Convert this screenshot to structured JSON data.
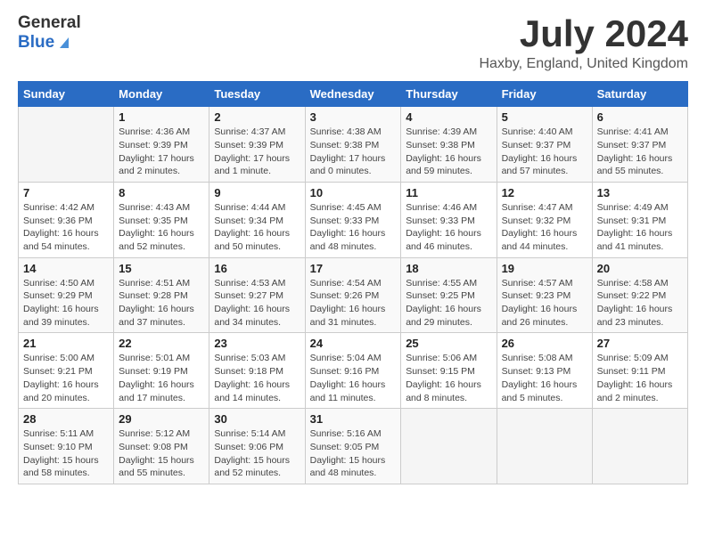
{
  "logo": {
    "general": "General",
    "blue": "Blue"
  },
  "title": "July 2024",
  "location": "Haxby, England, United Kingdom",
  "days_of_week": [
    "Sunday",
    "Monday",
    "Tuesday",
    "Wednesday",
    "Thursday",
    "Friday",
    "Saturday"
  ],
  "weeks": [
    [
      {
        "day": "",
        "info": ""
      },
      {
        "day": "1",
        "info": "Sunrise: 4:36 AM\nSunset: 9:39 PM\nDaylight: 17 hours\nand 2 minutes."
      },
      {
        "day": "2",
        "info": "Sunrise: 4:37 AM\nSunset: 9:39 PM\nDaylight: 17 hours\nand 1 minute."
      },
      {
        "day": "3",
        "info": "Sunrise: 4:38 AM\nSunset: 9:38 PM\nDaylight: 17 hours\nand 0 minutes."
      },
      {
        "day": "4",
        "info": "Sunrise: 4:39 AM\nSunset: 9:38 PM\nDaylight: 16 hours\nand 59 minutes."
      },
      {
        "day": "5",
        "info": "Sunrise: 4:40 AM\nSunset: 9:37 PM\nDaylight: 16 hours\nand 57 minutes."
      },
      {
        "day": "6",
        "info": "Sunrise: 4:41 AM\nSunset: 9:37 PM\nDaylight: 16 hours\nand 55 minutes."
      }
    ],
    [
      {
        "day": "7",
        "info": "Sunrise: 4:42 AM\nSunset: 9:36 PM\nDaylight: 16 hours\nand 54 minutes."
      },
      {
        "day": "8",
        "info": "Sunrise: 4:43 AM\nSunset: 9:35 PM\nDaylight: 16 hours\nand 52 minutes."
      },
      {
        "day": "9",
        "info": "Sunrise: 4:44 AM\nSunset: 9:34 PM\nDaylight: 16 hours\nand 50 minutes."
      },
      {
        "day": "10",
        "info": "Sunrise: 4:45 AM\nSunset: 9:33 PM\nDaylight: 16 hours\nand 48 minutes."
      },
      {
        "day": "11",
        "info": "Sunrise: 4:46 AM\nSunset: 9:33 PM\nDaylight: 16 hours\nand 46 minutes."
      },
      {
        "day": "12",
        "info": "Sunrise: 4:47 AM\nSunset: 9:32 PM\nDaylight: 16 hours\nand 44 minutes."
      },
      {
        "day": "13",
        "info": "Sunrise: 4:49 AM\nSunset: 9:31 PM\nDaylight: 16 hours\nand 41 minutes."
      }
    ],
    [
      {
        "day": "14",
        "info": "Sunrise: 4:50 AM\nSunset: 9:29 PM\nDaylight: 16 hours\nand 39 minutes."
      },
      {
        "day": "15",
        "info": "Sunrise: 4:51 AM\nSunset: 9:28 PM\nDaylight: 16 hours\nand 37 minutes."
      },
      {
        "day": "16",
        "info": "Sunrise: 4:53 AM\nSunset: 9:27 PM\nDaylight: 16 hours\nand 34 minutes."
      },
      {
        "day": "17",
        "info": "Sunrise: 4:54 AM\nSunset: 9:26 PM\nDaylight: 16 hours\nand 31 minutes."
      },
      {
        "day": "18",
        "info": "Sunrise: 4:55 AM\nSunset: 9:25 PM\nDaylight: 16 hours\nand 29 minutes."
      },
      {
        "day": "19",
        "info": "Sunrise: 4:57 AM\nSunset: 9:23 PM\nDaylight: 16 hours\nand 26 minutes."
      },
      {
        "day": "20",
        "info": "Sunrise: 4:58 AM\nSunset: 9:22 PM\nDaylight: 16 hours\nand 23 minutes."
      }
    ],
    [
      {
        "day": "21",
        "info": "Sunrise: 5:00 AM\nSunset: 9:21 PM\nDaylight: 16 hours\nand 20 minutes."
      },
      {
        "day": "22",
        "info": "Sunrise: 5:01 AM\nSunset: 9:19 PM\nDaylight: 16 hours\nand 17 minutes."
      },
      {
        "day": "23",
        "info": "Sunrise: 5:03 AM\nSunset: 9:18 PM\nDaylight: 16 hours\nand 14 minutes."
      },
      {
        "day": "24",
        "info": "Sunrise: 5:04 AM\nSunset: 9:16 PM\nDaylight: 16 hours\nand 11 minutes."
      },
      {
        "day": "25",
        "info": "Sunrise: 5:06 AM\nSunset: 9:15 PM\nDaylight: 16 hours\nand 8 minutes."
      },
      {
        "day": "26",
        "info": "Sunrise: 5:08 AM\nSunset: 9:13 PM\nDaylight: 16 hours\nand 5 minutes."
      },
      {
        "day": "27",
        "info": "Sunrise: 5:09 AM\nSunset: 9:11 PM\nDaylight: 16 hours\nand 2 minutes."
      }
    ],
    [
      {
        "day": "28",
        "info": "Sunrise: 5:11 AM\nSunset: 9:10 PM\nDaylight: 15 hours\nand 58 minutes."
      },
      {
        "day": "29",
        "info": "Sunrise: 5:12 AM\nSunset: 9:08 PM\nDaylight: 15 hours\nand 55 minutes."
      },
      {
        "day": "30",
        "info": "Sunrise: 5:14 AM\nSunset: 9:06 PM\nDaylight: 15 hours\nand 52 minutes."
      },
      {
        "day": "31",
        "info": "Sunrise: 5:16 AM\nSunset: 9:05 PM\nDaylight: 15 hours\nand 48 minutes."
      },
      {
        "day": "",
        "info": ""
      },
      {
        "day": "",
        "info": ""
      },
      {
        "day": "",
        "info": ""
      }
    ]
  ]
}
